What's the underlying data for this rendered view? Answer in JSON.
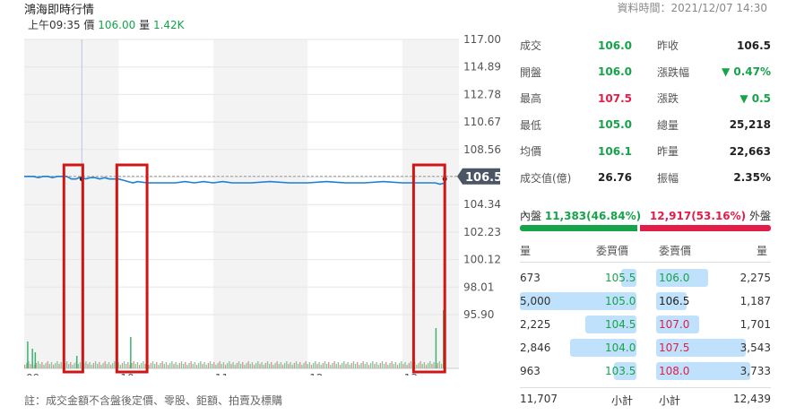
{
  "header": {
    "title": "鴻海即時行情",
    "data_time": "資料時間：2021/12/07 14:30",
    "time_label": "上午09:35",
    "price_label": "價",
    "price_value": "106.00",
    "volume_label": "量",
    "volume_value": "1.42K"
  },
  "chart_data": {
    "type": "line",
    "x_ticks": [
      "09",
      "10",
      "11",
      "12",
      "13"
    ],
    "y_ticks": [
      117.0,
      114.89,
      112.78,
      110.67,
      108.56,
      106.45,
      104.34,
      102.23,
      100.12,
      98.01,
      95.9
    ],
    "y_tick_labels": [
      "117.00",
      "114.89",
      "112.78",
      "110.67",
      "108.56",
      "",
      "104.34",
      "102.23",
      "100.12",
      "98.01",
      "95.90"
    ],
    "ylim": [
      95.9,
      117.0
    ],
    "reference_price": 106.5,
    "current_price_label": "106.50",
    "cursor_time": "09:35",
    "series": [
      {
        "values_time": [
          0.0,
          0.05,
          0.1,
          0.15,
          0.2,
          0.25,
          0.3,
          0.35,
          0.4,
          0.45,
          0.5,
          0.55,
          0.58,
          0.62,
          0.65,
          0.7,
          0.75,
          0.8,
          0.85,
          0.9,
          1.0,
          1.05,
          1.1,
          1.15,
          1.2,
          1.3,
          1.4,
          1.5,
          1.6,
          1.7,
          1.8,
          1.9,
          2.0,
          2.1,
          2.2,
          2.4,
          2.6,
          2.8,
          3.0,
          3.2,
          3.4,
          3.6,
          3.8,
          4.0,
          4.1,
          4.2,
          4.28,
          4.35,
          4.4,
          4.45
        ],
        "values": [
          106.5,
          106.5,
          106.5,
          106.4,
          106.5,
          106.5,
          106.4,
          106.5,
          106.5,
          106.5,
          106.3,
          106.3,
          106.4,
          106.4,
          106.3,
          106.4,
          106.4,
          106.3,
          106.4,
          106.3,
          106.3,
          106.2,
          106.1,
          106.0,
          106.1,
          106.0,
          106.0,
          106.0,
          106.0,
          106.1,
          106.0,
          106.1,
          106.0,
          106.1,
          106.0,
          106.0,
          106.1,
          106.0,
          106.0,
          106.1,
          106.0,
          106.0,
          106.1,
          106.0,
          106.0,
          106.0,
          106.0,
          106.0,
          105.9,
          106.0
        ]
      }
    ],
    "volume_spikes": [
      {
        "time": 0.03,
        "value": 30
      },
      {
        "time": 0.08,
        "value": 22
      },
      {
        "time": 0.11,
        "value": 18
      },
      {
        "time": 0.55,
        "value": 14
      },
      {
        "time": 1.12,
        "value": 35
      },
      {
        "time": 4.35,
        "value": 45
      },
      {
        "time": 4.43,
        "value": 65
      }
    ],
    "highlight_boxes_times": [
      [
        0.42,
        0.62
      ],
      [
        0.98,
        1.3
      ],
      [
        4.12,
        4.45
      ]
    ]
  },
  "stats": [
    {
      "label": "成交",
      "value": "106.0",
      "color": "#16a34a",
      "label2": "昨收",
      "value2": "106.5",
      "color2": "#222"
    },
    {
      "label": "開盤",
      "value": "106.0",
      "color": "#16a34a",
      "label2": "漲跌幅",
      "value2": "▼ 0.47%",
      "color2": "#16a34a"
    },
    {
      "label": "最高",
      "value": "107.5",
      "color": "#e11d48",
      "label2": "漲跌",
      "value2": "▼ 0.5",
      "color2": "#16a34a"
    },
    {
      "label": "最低",
      "value": "105.0",
      "color": "#16a34a",
      "label2": "總量",
      "value2": "25,218",
      "color2": "#222"
    },
    {
      "label": "均價",
      "value": "106.1",
      "color": "#16a34a",
      "label2": "昨量",
      "value2": "22,663",
      "color2": "#222"
    },
    {
      "label": "成交值(億)",
      "value": "26.76",
      "color": "#222",
      "label2": "振幅",
      "value2": "2.35%",
      "color2": "#222"
    }
  ],
  "inout": {
    "inner_label": "內盤",
    "inner_value": "11,383(46.84%)",
    "inner_ratio": 0.4684,
    "outer_value": "12,917(53.16%)",
    "outer_label": "外盤"
  },
  "orderbook": {
    "headers": {
      "qty_buy": "量",
      "bid": "委買價",
      "ask": "委賣價",
      "qty_sell": "量"
    },
    "rows": [
      {
        "bid_qty": "673",
        "bid": "105.5",
        "bid_fill": 0.13,
        "ask": "106.0",
        "ask_color": "#16a34a",
        "ask_fill": 0.55,
        "ask_qty": "2,275"
      },
      {
        "bid_qty": "5,000",
        "bid": "105.0",
        "bid_fill": 1.0,
        "ask": "106.5",
        "ask_color": "#222",
        "ask_fill": 0.32,
        "ask_qty": "1,187"
      },
      {
        "bid_qty": "2,225",
        "bid": "104.5",
        "bid_fill": 0.44,
        "ask": "107.0",
        "ask_color": "#e11d48",
        "ask_fill": 0.46,
        "ask_qty": "1,701"
      },
      {
        "bid_qty": "2,846",
        "bid": "104.0",
        "bid_fill": 0.57,
        "ask": "107.5",
        "ask_color": "#e11d48",
        "ask_fill": 0.95,
        "ask_qty": "3,543"
      },
      {
        "bid_qty": "963",
        "bid": "103.5",
        "bid_fill": 0.19,
        "ask": "108.0",
        "ask_color": "#e11d48",
        "ask_fill": 1.0,
        "ask_qty": "3,733"
      }
    ],
    "footer": {
      "bid_total": "11,707",
      "bid_label": "小計",
      "ask_label": "小計",
      "ask_total": "12,439"
    }
  },
  "footnote": "註：成交金額不含盤後定價、零股、鉅額、拍賣及標購"
}
